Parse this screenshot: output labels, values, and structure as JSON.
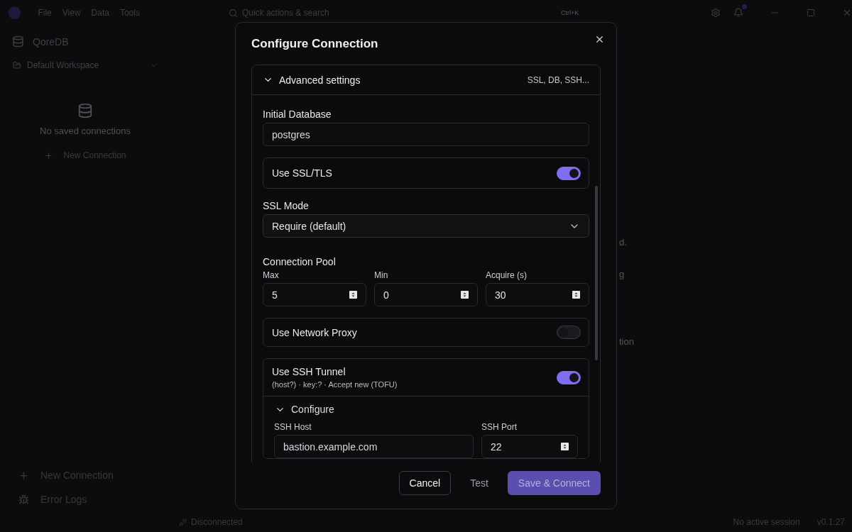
{
  "menu": [
    "File",
    "View",
    "Data",
    "Tools"
  ],
  "search": {
    "placeholder": "Quick actions & search",
    "shortcut": "Ctrl+K"
  },
  "notifications": {
    "unread": true
  },
  "sidebar": {
    "app_name": "QoreDB",
    "workspace": "Default Workspace",
    "empty_text": "No saved connections",
    "new_connection": "New Connection",
    "footer": [
      {
        "kind": "new",
        "label": "New Connection"
      },
      {
        "kind": "logs",
        "label": "Error Logs"
      }
    ]
  },
  "background_fragments": [
    "d.",
    "g",
    "tion"
  ],
  "dialog": {
    "title": "Configure Connection",
    "section": {
      "title": "Advanced settings",
      "summary": "SSL, DB, SSH...",
      "expanded": true
    },
    "fields": [
      {
        "kind": "text",
        "label": "Initial Database",
        "value": "postgres"
      },
      {
        "kind": "toggle",
        "label": "Use SSL/TLS",
        "on": true
      },
      {
        "kind": "select",
        "label": "SSL Mode",
        "value": "Require (default)"
      },
      {
        "kind": "numbers",
        "label": "Connection Pool",
        "items": [
          {
            "label": "Max",
            "value": "5"
          },
          {
            "label": "Min",
            "value": "0"
          },
          {
            "label": "Acquire (s)",
            "value": "30"
          }
        ]
      },
      {
        "kind": "toggle",
        "label": "Use Network Proxy",
        "on": false
      },
      {
        "kind": "toggle",
        "label": "Use SSH Tunnel",
        "on": true,
        "subtitle": "(host?) · key:? · Accept new (TOFU)",
        "sub": {
          "title": "Configure",
          "expanded": true,
          "host_label": "SSH Host",
          "host_value": "bastion.example.com",
          "port_label": "SSH Port",
          "port_value": "22"
        }
      }
    ],
    "buttons": [
      {
        "kind": "outline",
        "label": "Cancel"
      },
      {
        "kind": "ghost",
        "label": "Test"
      },
      {
        "kind": "primary",
        "label": "Save & Connect",
        "disabled": true
      }
    ]
  },
  "status_bar": {
    "connection": "Disconnected",
    "session": "No active session",
    "version": "v0.1.27"
  }
}
